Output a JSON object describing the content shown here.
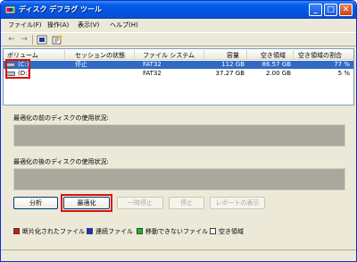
{
  "window": {
    "title": "ディスク デフラグ ツール"
  },
  "menu": [
    "ファイル(F)",
    "操作(A)",
    "表示(V)",
    "ヘルプ(H)"
  ],
  "toolbar": {
    "back_icon": "back-arrow-icon",
    "forward_icon": "forward-arrow-icon",
    "view_icon": "properties-icon",
    "help_icon": "help-icon"
  },
  "volumes": {
    "columns": [
      "ボリューム",
      "セッションの状態",
      "ファイル システム",
      "容量",
      "空き領域",
      "空き領域の割合"
    ],
    "rows": [
      {
        "name": "(C:)",
        "status": "停止",
        "fs": "FAT32",
        "capacity": "112 GB",
        "free": "86.57 GB",
        "pct": "77 %",
        "selected": true
      },
      {
        "name": "(D:)",
        "status": "",
        "fs": "FAT32",
        "capacity": "37.27 GB",
        "free": "2.00 GB",
        "pct": "5 %",
        "selected": false
      }
    ]
  },
  "usage": {
    "before_label": "最適化の前のディスクの使用状況:",
    "after_label": "最適化の後のディスクの使用状況:"
  },
  "buttons": {
    "analyze": "分析",
    "defrag": "最適化",
    "pause": "一時停止",
    "stop": "停止",
    "report": "レポートの表示"
  },
  "legend": [
    {
      "label": "断片化されたファイル",
      "color": "#e01010"
    },
    {
      "label": "連続ファイル",
      "color": "#1030d8"
    },
    {
      "label": "移動できないファイル",
      "color": "#10c010"
    },
    {
      "label": "空き領域",
      "color": "#ffffff"
    }
  ],
  "colors": {
    "selection": "#316ac5",
    "titlebar": "#0054e3",
    "highlight_box": "#e01010"
  }
}
